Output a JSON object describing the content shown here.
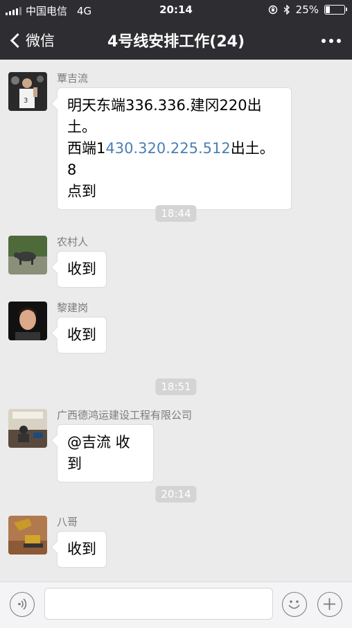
{
  "status_bar": {
    "carrier": "中国电信",
    "network": "4G",
    "time": "20:14",
    "battery": "25%",
    "battery_level": 0.25
  },
  "nav": {
    "back_label": "微信",
    "title": "4号线安排工作(24)",
    "more_icon": "more-dots-icon"
  },
  "messages": [
    {
      "sender": "覃吉流",
      "text_1": "明天东端336.336.建冈220出",
      "text_2": "土。",
      "text_3a": "西端1",
      "text_3_link": "430.320.225.512",
      "text_3b": "出土。8",
      "text_4": "点到"
    },
    {
      "sender": "农村人",
      "text": "收到"
    },
    {
      "sender": "黎建岗",
      "text": "收到"
    },
    {
      "sender": "广西德鸿运建设工程有限公司",
      "text": "@吉流 收到"
    },
    {
      "sender": "八哥",
      "text": "收到"
    }
  ],
  "timestamps": [
    "18:44",
    "18:51",
    "20:14"
  ],
  "input": {
    "placeholder": ""
  },
  "colors": {
    "header": "#2e2e32",
    "background": "#ebebeb",
    "link": "#4a7fb5",
    "pill": "#d4d4d4"
  }
}
